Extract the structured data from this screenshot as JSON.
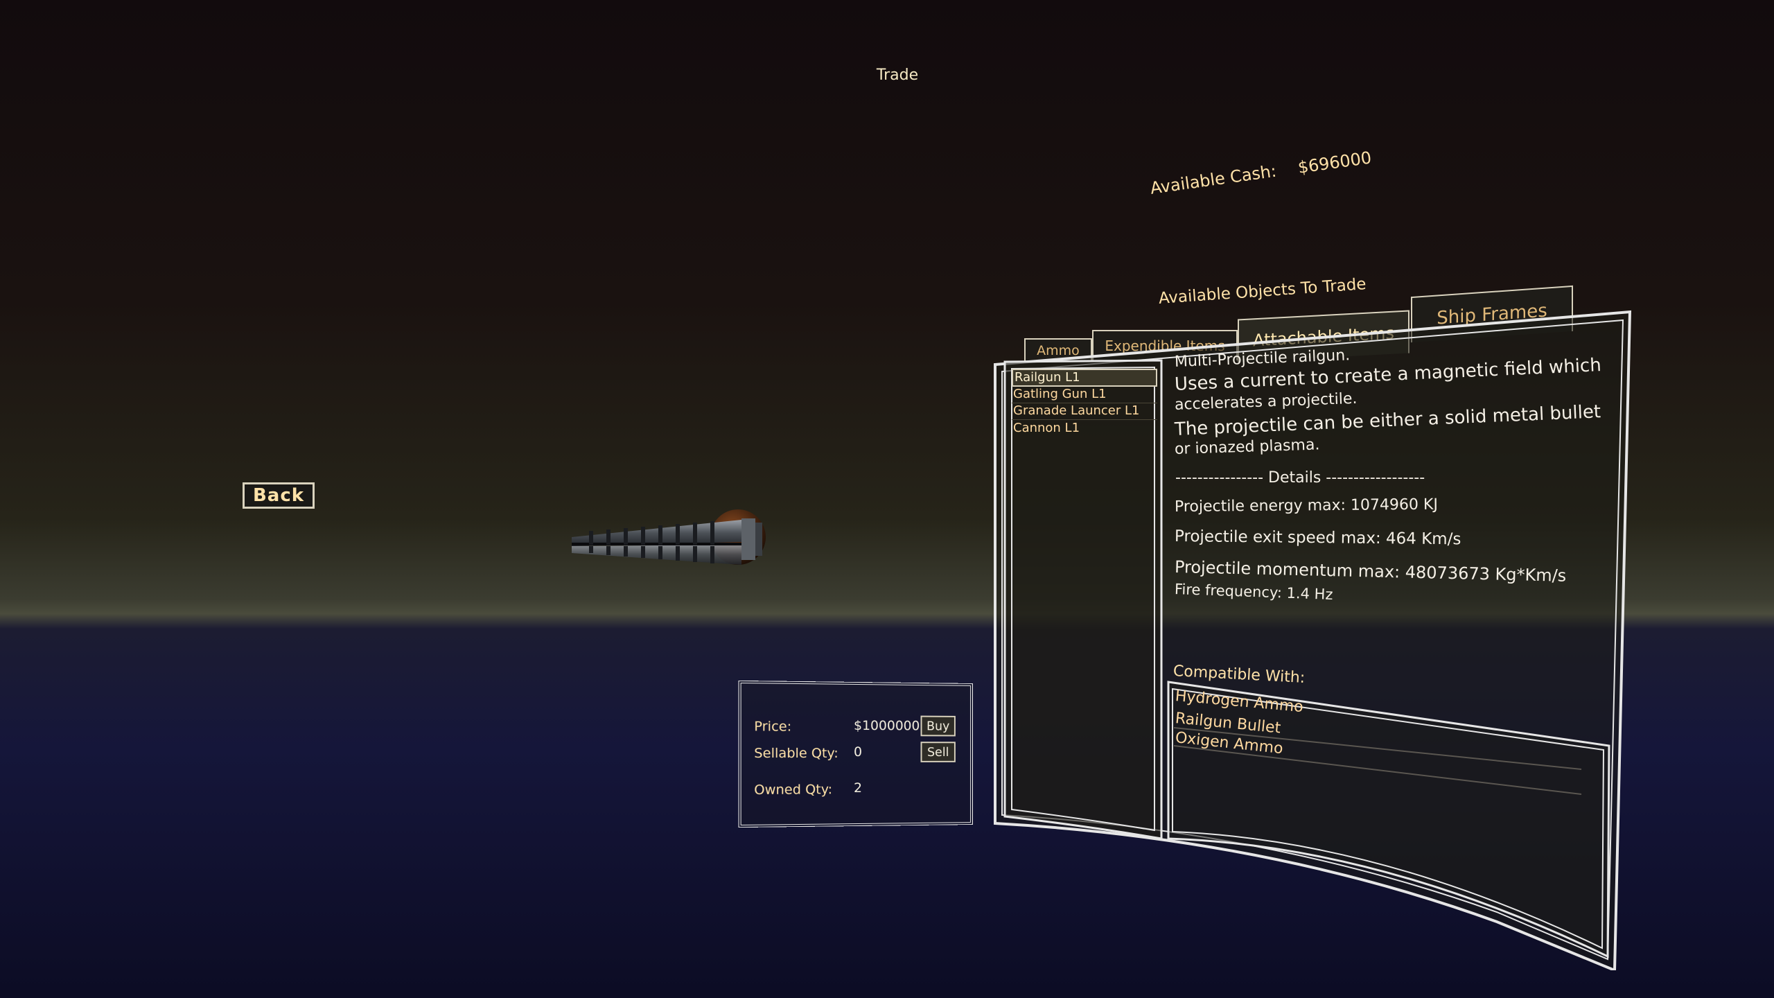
{
  "screen": {
    "title": "Trade"
  },
  "cash": {
    "label": "Available Cash:",
    "value": "$696000"
  },
  "back_button": {
    "label": "Back"
  },
  "trade": {
    "title": "Available Objects To Trade",
    "tabs": [
      {
        "label": "Ammo",
        "active": false
      },
      {
        "label": "Expendible Items",
        "active": false
      },
      {
        "label": "Attachable Items",
        "active": true
      },
      {
        "label": "Ship Frames",
        "active": false
      }
    ],
    "items": [
      {
        "label": "Railgun L1",
        "selected": true
      },
      {
        "label": "Gatling Gun L1",
        "selected": false
      },
      {
        "label": "Granade Launcer L1",
        "selected": false
      },
      {
        "label": "Cannon L1",
        "selected": false
      }
    ],
    "description": {
      "line1": "Multi-Projectile railgun.",
      "line2a": "Uses a current to create a magnetic field which",
      "line2b": "accelerates a projectile.",
      "line3a": "The projectile can be either a solid metal bullet",
      "line3b": "or ionazed plasma.",
      "details_header": "---------------- Details ------------------",
      "energy": "Projectile energy max: 1074960 KJ",
      "speed": "Projectile exit speed max: 464 Km/s",
      "momentum": "Projectile momentum max: 48073673 Kg*Km/s",
      "frequency": "Fire frequency: 1.4 Hz"
    },
    "compatible": {
      "title": "Compatible With:",
      "items": [
        "Hydrogen Ammo",
        "Railgun Bullet",
        "Oxigen Ammo"
      ]
    }
  },
  "price_panel": {
    "price_label": "Price:",
    "price_value": "$1000000",
    "buy_label": "Buy",
    "sellable_label": "Sellable Qty:",
    "sellable_value": "0",
    "sell_label": "Sell",
    "owned_label": "Owned Qty:",
    "owned_value": "2"
  },
  "colors": {
    "accent_text": "#ffe2a8",
    "frame": "#e6e6e6",
    "panel_bg": "#1e1c18"
  }
}
